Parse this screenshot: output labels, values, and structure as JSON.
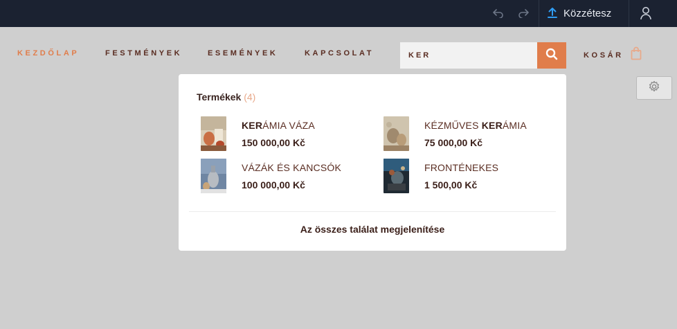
{
  "topbar": {
    "undo_icon": "undo-arrow-icon",
    "redo_icon": "redo-arrow-icon",
    "publish_label": "Közzétesz",
    "publish_icon": "upload-icon",
    "account_icon": "user-icon"
  },
  "nav": {
    "items": [
      {
        "label": "KEZDŐLAP",
        "active": true
      },
      {
        "label": "FESTMÉNYEK",
        "active": false
      },
      {
        "label": "ESEMÉNYEK",
        "active": false
      },
      {
        "label": "KAPCSOLAT",
        "active": false
      }
    ],
    "search_value": "KER",
    "search_icon": "search-icon",
    "cart_label": "KOSÁR",
    "cart_icon": "shopping-bag-icon",
    "settings_icon": "gear-icon"
  },
  "results": {
    "heading": "Termékek",
    "count": "(4)",
    "products": [
      {
        "name_bold": "KER",
        "name_rest": "ÁMIA VÁZA",
        "name_prefix": "",
        "price": "150 000,00 Kč"
      },
      {
        "name_prefix": "KÉZMŰVES ",
        "name_bold": "KER",
        "name_rest": "ÁMIA",
        "price": "75 000,00 Kč"
      },
      {
        "name_prefix": "VÁZÁK ÉS KANCSÓK",
        "name_bold": "",
        "name_rest": "",
        "price": "100 000,00 Kč"
      },
      {
        "name_prefix": "FRONTÉNEKES",
        "name_bold": "",
        "name_rest": "",
        "price": "1 500,00 Kč"
      }
    ],
    "show_all_label": "Az összes találat megjelenítése"
  },
  "colors": {
    "accent": "#e07d4b",
    "topbar": "#1b2231",
    "text_dark": "#5a2d22",
    "page_bg": "#cfcfcf"
  }
}
